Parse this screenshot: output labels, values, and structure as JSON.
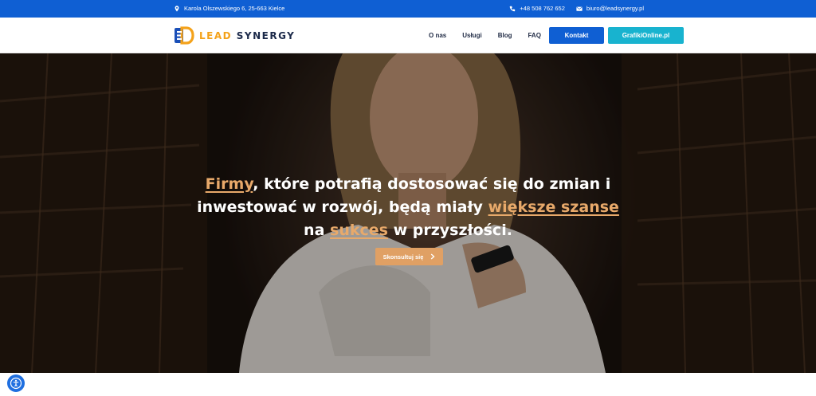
{
  "topbar": {
    "address": "Karola Olszewskiego 6, 25-663 Kielce",
    "phone": "+48 508 762 652",
    "email": "biuro@leadsynergy.pl"
  },
  "header": {
    "logo_part1": "LEAD",
    "logo_part2": " SYNERGY",
    "nav": [
      "O nas",
      "Usługi",
      "Blog",
      "FAQ"
    ],
    "contact_button": "Kontakt",
    "grafiki_button": "GrafikiOnline.pl"
  },
  "hero": {
    "headline_1": "Firmy",
    "headline_2": ", które potrafią dostosować się do zmian i inwestować w rozwój, będą miały ",
    "headline_3": "większe szanse",
    "headline_4": " na ",
    "headline_5": "sukces",
    "headline_6": " w przyszłości.",
    "cta_label": "Skonsultuj się"
  },
  "colors": {
    "brand_blue": "#0f5fd3",
    "cyan": "#18b3cf",
    "accent_orange": "#e0a064",
    "logo_orange": "#f4a21a"
  },
  "icons": [
    "location-pin-icon",
    "phone-icon",
    "mail-icon",
    "chevron-right-icon",
    "accessibility-icon"
  ]
}
